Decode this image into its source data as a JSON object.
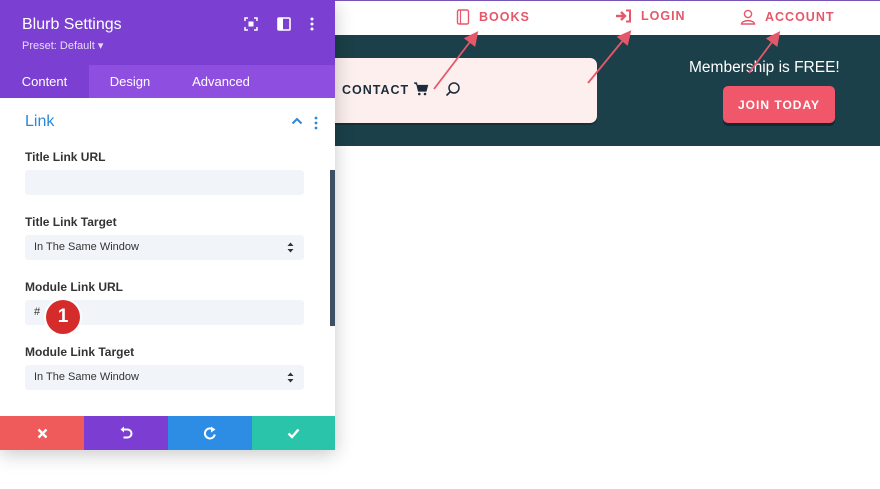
{
  "colors": {
    "accent_pink": "#e5586a",
    "band": "#1b4049",
    "panel_purple": "#7b3fd1",
    "panel_tabbar": "#8e4fe0",
    "link_blue": "#2b87da",
    "badge_red": "#d62b2b"
  },
  "header": {
    "links": [
      {
        "label": "BOOKS",
        "icon": "book-icon"
      },
      {
        "label": "LOGIN",
        "icon": "login-icon"
      },
      {
        "label": "ACCOUNT",
        "icon": "user-icon"
      }
    ]
  },
  "hero": {
    "nav_contact": "CONTACT",
    "promo_text": "Membership is FREE!",
    "join_button": "JOIN TODAY"
  },
  "panel": {
    "title": "Blurb Settings",
    "preset": "Preset: Default ▾",
    "tabs": [
      "Content",
      "Design",
      "Advanced"
    ],
    "active_tab": "Content",
    "section_title": "Link",
    "fields": {
      "title_link_url": {
        "label": "Title Link URL",
        "value": ""
      },
      "title_link_target": {
        "label": "Title Link Target",
        "value": "In The Same Window"
      },
      "module_link_url": {
        "label": "Module Link URL",
        "value": "#"
      },
      "module_link_target": {
        "label": "Module Link Target",
        "value": "In The Same Window"
      }
    },
    "badge": "1"
  }
}
